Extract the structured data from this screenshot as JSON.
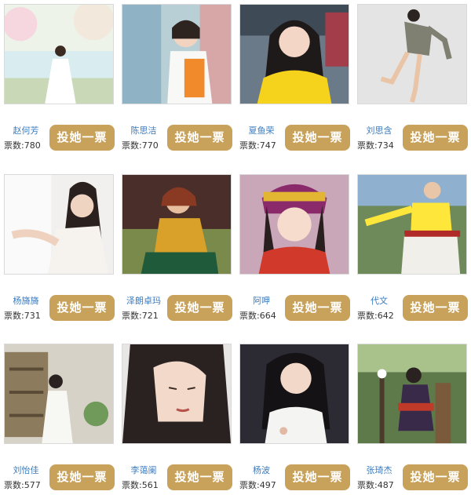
{
  "vote_button_label": "投她一票",
  "votes_prefix": "票数:",
  "accent_color": "#c8a15a",
  "name_color": "#3a7bbf",
  "candidates": [
    {
      "name": "赵何芳",
      "votes": "780"
    },
    {
      "name": "陈思洁",
      "votes": "770"
    },
    {
      "name": "夏鱼荣",
      "votes": "747"
    },
    {
      "name": "刘思含",
      "votes": "734"
    },
    {
      "name": "杨旖旖",
      "votes": "731"
    },
    {
      "name": "泽朗卓玛",
      "votes": "721"
    },
    {
      "name": "阿呷",
      "votes": "664"
    },
    {
      "name": "代文",
      "votes": "642"
    },
    {
      "name": "刘怡佳",
      "votes": "577"
    },
    {
      "name": "李蔼阑",
      "votes": "561"
    },
    {
      "name": "杨波",
      "votes": "497"
    },
    {
      "name": "张琦杰",
      "votes": "487"
    }
  ]
}
